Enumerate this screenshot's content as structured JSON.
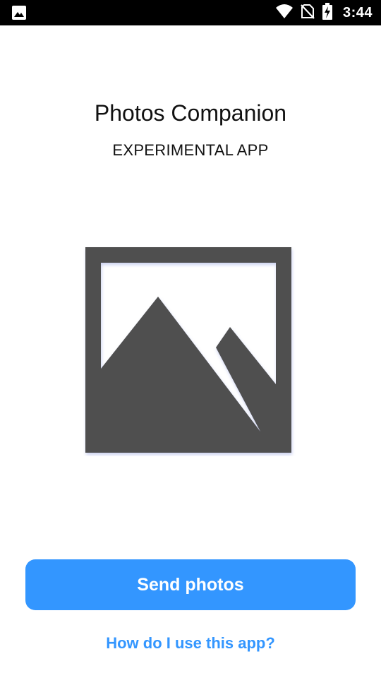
{
  "status_bar": {
    "time": "3:44",
    "icons": [
      "image-notification-icon",
      "wifi-icon",
      "no-sim-icon",
      "battery-charging-icon"
    ]
  },
  "header": {
    "title": "Photos Companion",
    "subtitle": "EXPERIMENTAL APP"
  },
  "hero": {
    "icon": "photo-placeholder-icon",
    "color": "#505050"
  },
  "actions": {
    "primary_label": "Send photos",
    "help_link": "How do I use this app?"
  },
  "colors": {
    "accent": "#3396ff",
    "status_bar": "#000000",
    "text": "#111111"
  }
}
